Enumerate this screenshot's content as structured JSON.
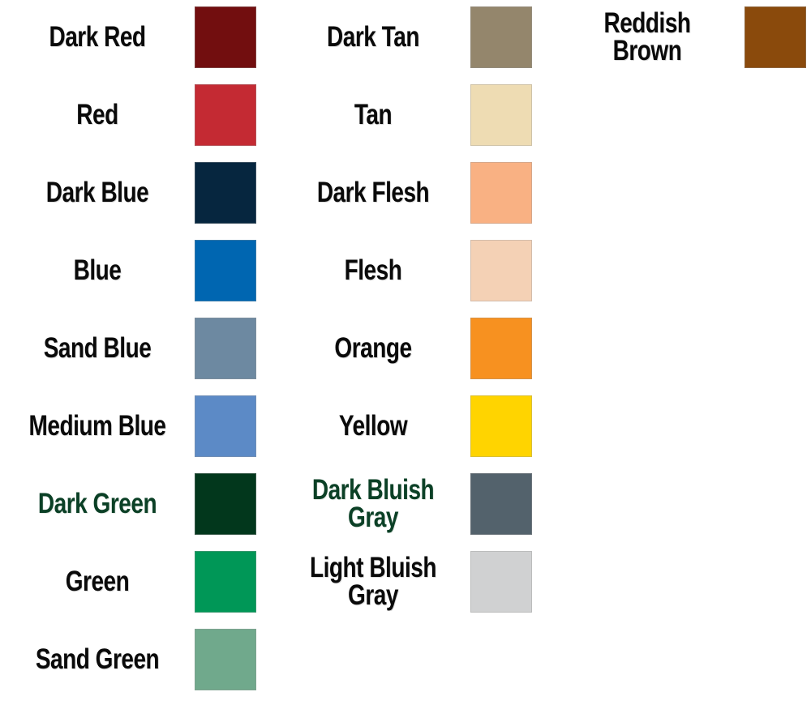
{
  "chart_data": {
    "type": "table",
    "title": "",
    "subtitle": "",
    "xlabel": "",
    "ylabel": "",
    "legend_position": "full-figure",
    "grid": false,
    "description": "Color legend swatch chart: named colors paired with filled color squares, arranged in three columns.",
    "columns": [
      {
        "name": "column-1",
        "entries": [
          {
            "label": "Dark Red",
            "color": "#720E0F",
            "label_color": "#0a0a0a",
            "row": 1
          },
          {
            "label": "Red",
            "color": "#C42A33",
            "label_color": "#0a0a0a",
            "row": 2
          },
          {
            "label": "Dark Blue",
            "color": "#06263F",
            "label_color": "#0a0a0a",
            "row": 3
          },
          {
            "label": "Blue",
            "color": "#0066B1",
            "label_color": "#0a0a0a",
            "row": 4
          },
          {
            "label": "Sand Blue",
            "color": "#6D89A1",
            "label_color": "#0a0a0a",
            "row": 5
          },
          {
            "label": "Medium Blue",
            "color": "#5C8AC6",
            "label_color": "#0a0a0a",
            "row": 6
          },
          {
            "label": "Dark Green",
            "color": "#02371C",
            "label_color": "#0b4026",
            "row": 7
          },
          {
            "label": "Green",
            "color": "#009757",
            "label_color": "#0a0a0a",
            "row": 8
          },
          {
            "label": "Sand Green",
            "color": "#70A98C",
            "label_color": "#0a0a0a",
            "row": 9
          }
        ]
      },
      {
        "name": "column-2",
        "entries": [
          {
            "label": "Dark Tan",
            "color": "#94866C",
            "label_color": "#0a0a0a",
            "row": 1
          },
          {
            "label": "Tan",
            "color": "#EEDCB3",
            "label_color": "#0a0a0a",
            "row": 2
          },
          {
            "label": "Dark Flesh",
            "color": "#F9B183",
            "label_color": "#0a0a0a",
            "row": 3
          },
          {
            "label": "Flesh",
            "color": "#F4D1B5",
            "label_color": "#0a0a0a",
            "row": 4
          },
          {
            "label": "Orange",
            "color": "#F79120",
            "label_color": "#0a0a0a",
            "row": 5
          },
          {
            "label": "Yellow",
            "color": "#FFD400",
            "label_color": "#0a0a0a",
            "row": 6
          },
          {
            "label": "Dark Bluish\nGray",
            "color": "#53626C",
            "label_color": "#0b4026",
            "row": 7
          },
          {
            "label": "Light Bluish\nGray",
            "color": "#D0D1D2",
            "label_color": "#0a0a0a",
            "row": 8
          }
        ]
      },
      {
        "name": "column-3",
        "entries": [
          {
            "label": "Reddish\nBrown",
            "color": "#8A4A0C",
            "label_color": "#0a0a0a",
            "row": 1
          }
        ]
      }
    ]
  },
  "layout": {
    "row_pitch": 96,
    "row_origin": 4,
    "swatch_size": 76
  }
}
